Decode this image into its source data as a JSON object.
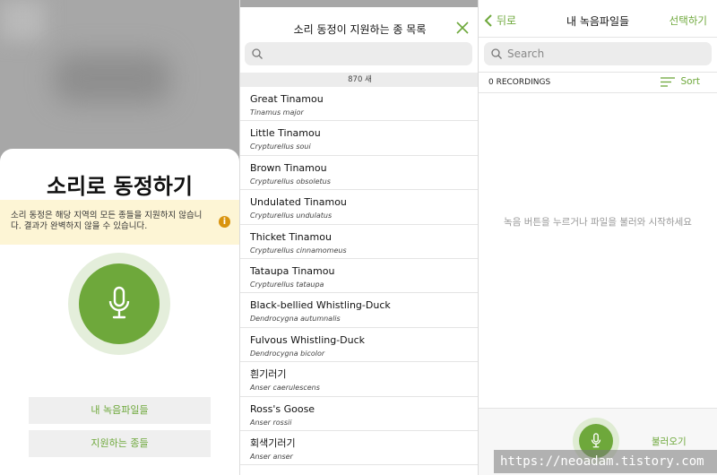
{
  "panel1": {
    "title": "소리로 동정하기",
    "notice": "소리 동정은 해당 지역의 모든 종들을 지원하지 않습니다. 결과가 완벽하지 않을 수 있습니다.",
    "notice_icon": "info-icon",
    "mic_icon": "microphone-icon",
    "my_recordings_button": "내 녹음파일들",
    "supported_species_button": "지원하는 종들"
  },
  "panel2": {
    "title": "소리 동정이 지원하는 종 목록",
    "close_icon": "close-icon",
    "search_placeholder": "",
    "count": "870 새",
    "species": [
      {
        "common": "Great Tinamou",
        "scientific": "Tinamus major"
      },
      {
        "common": "Little Tinamou",
        "scientific": "Crypturellus soui"
      },
      {
        "common": "Brown Tinamou",
        "scientific": "Crypturellus obsoletus"
      },
      {
        "common": "Undulated Tinamou",
        "scientific": "Crypturellus undulatus"
      },
      {
        "common": "Thicket Tinamou",
        "scientific": "Crypturellus cinnamomeus"
      },
      {
        "common": "Tataupa Tinamou",
        "scientific": "Crypturellus tataupa"
      },
      {
        "common": "Black-bellied Whistling-Duck",
        "scientific": "Dendrocygna autumnalis"
      },
      {
        "common": "Fulvous Whistling-Duck",
        "scientific": "Dendrocygna bicolor"
      },
      {
        "common": "흰기러기",
        "scientific": "Anser caerulescens"
      },
      {
        "common": "Ross's Goose",
        "scientific": "Anser rossii"
      },
      {
        "common": "회색기러기",
        "scientific": "Anser anser"
      }
    ]
  },
  "panel3": {
    "back_label": "뒤로",
    "title": "내 녹음파일들",
    "select_label": "선택하기",
    "search_placeholder": "Search",
    "recordings_count": "0 RECORDINGS",
    "sort_label": "Sort",
    "empty_message": "녹음 버튼을 누르거나 파일을 불러와 시작하세요",
    "import_label": "불러오기"
  },
  "watermark": "https://neoadam.tistory.com",
  "colors": {
    "accent": "#6ea83b",
    "notice_bg": "#fdf5d5",
    "notice_icon": "#d9940f"
  }
}
